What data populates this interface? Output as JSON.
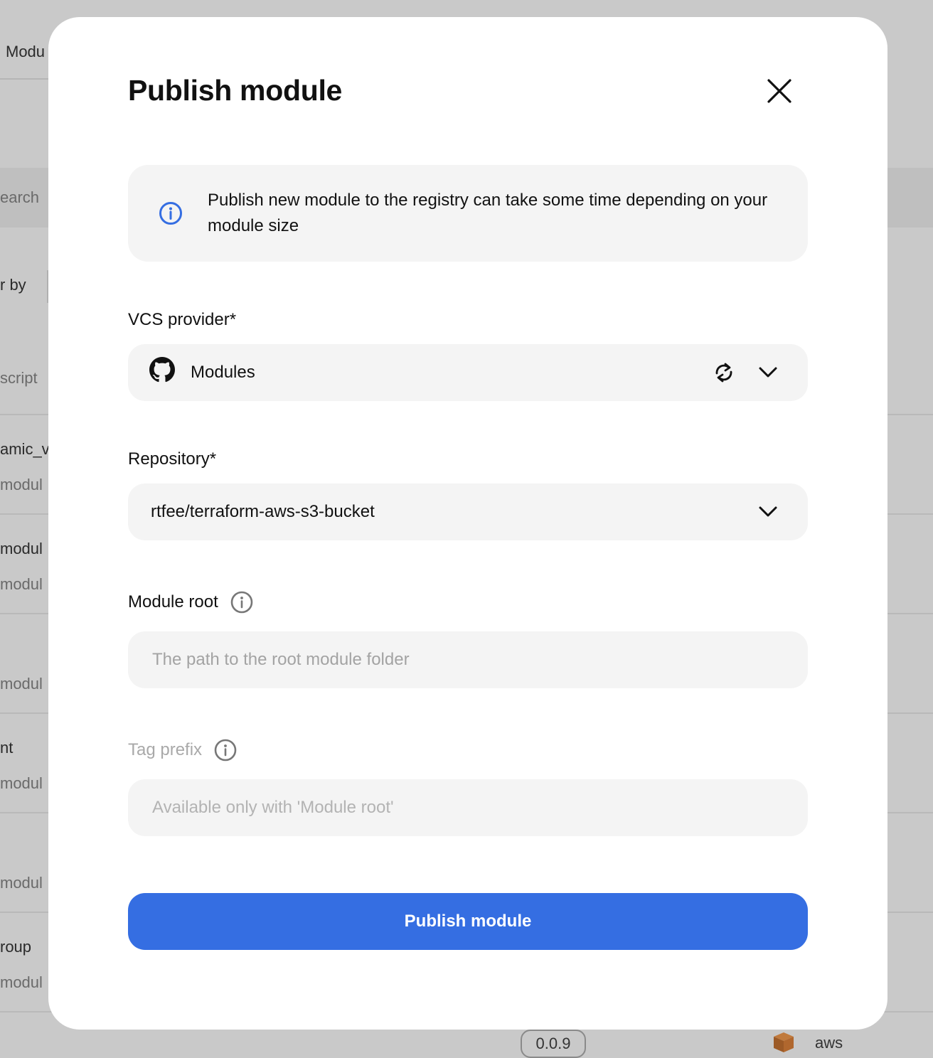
{
  "background": {
    "tab_label": "Modu",
    "search_partial": "earch",
    "filter_partial": "r by",
    "description_partial": "script",
    "rows": [
      {
        "name": "amic_v",
        "sub": "modul"
      },
      {
        "name": "modul",
        "sub": "modul"
      },
      {
        "name": "",
        "sub": "modul"
      },
      {
        "name": "nt",
        "sub": "modul"
      },
      {
        "name": "",
        "sub": "modul"
      },
      {
        "name": "roup",
        "sub": "modul"
      }
    ],
    "version_badge": "0.0.9",
    "provider_label": "aws"
  },
  "modal": {
    "title": "Publish module",
    "info_text": "Publish new module to the registry can take some time depending on your module size",
    "vcs_provider": {
      "label": "VCS provider*",
      "value": "Modules"
    },
    "repository": {
      "label": "Repository*",
      "value": "rtfee/terraform-aws-s3-bucket"
    },
    "module_root": {
      "label": "Module root",
      "placeholder": "The path to the root module folder"
    },
    "tag_prefix": {
      "label": "Tag prefix",
      "placeholder": "Available only with 'Module root'"
    },
    "submit_label": "Publish module"
  },
  "colors": {
    "accent": "#356ee2",
    "info_icon": "#356ee2",
    "overlay": "#c9c9c9"
  },
  "icons": [
    "close-icon",
    "info-icon",
    "github-icon",
    "refresh-icon",
    "chevron-down-icon",
    "aws-cube-icon"
  ]
}
